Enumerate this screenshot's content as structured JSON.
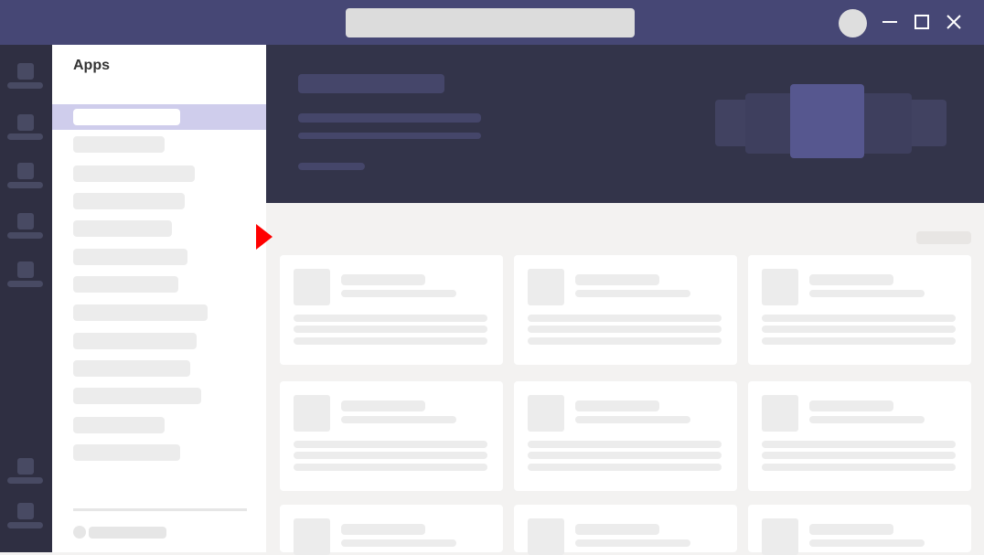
{
  "window": {
    "search_placeholder": "",
    "min_icon": "minimize-icon",
    "max_icon": "maximize-icon",
    "close_icon": "close-icon"
  },
  "panel": {
    "title": "Apps"
  },
  "colors": {
    "titlebar": "#464775",
    "rail": "#2f2f42",
    "hero": "#33344a",
    "selection": "#cfcdec",
    "indicator": "#ff0000"
  }
}
